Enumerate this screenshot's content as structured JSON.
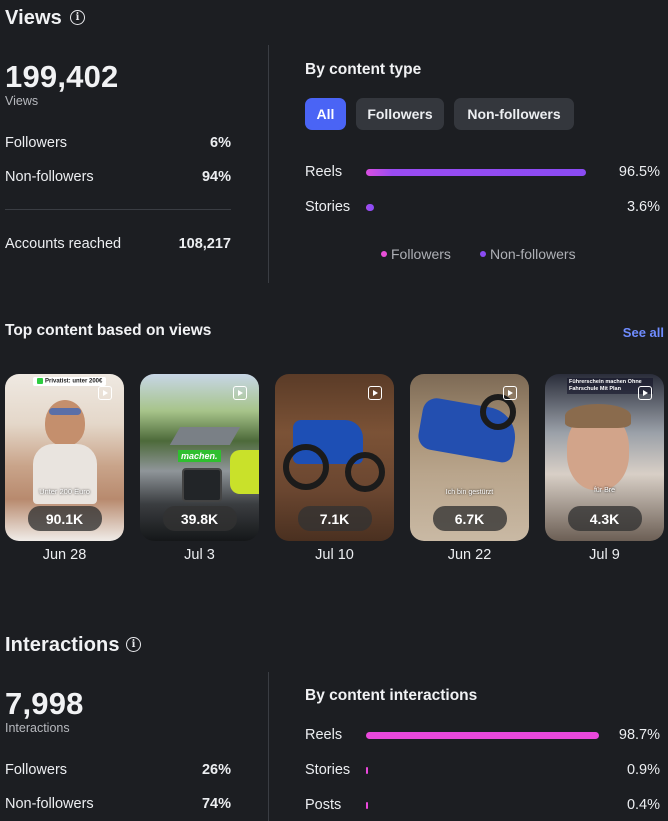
{
  "views": {
    "title": "Views",
    "total": "199,402",
    "total_label": "Views",
    "rows": [
      {
        "label": "Followers",
        "value": "6%"
      },
      {
        "label": "Non-followers",
        "value": "94%"
      }
    ],
    "accounts_reached_label": "Accounts reached",
    "accounts_reached_value": "108,217",
    "by_content": {
      "title": "By content type",
      "filters": [
        "All",
        "Followers",
        "Non-followers"
      ],
      "active_filter": "All",
      "bars": [
        {
          "label": "Reels",
          "value": "96.5%",
          "fraction": 0.965
        },
        {
          "label": "Stories",
          "value": "3.6%",
          "fraction": 0.036
        }
      ],
      "legend": [
        {
          "label": "Followers",
          "color": "#e84fd8"
        },
        {
          "label": "Non-followers",
          "color": "#8a4bf3"
        }
      ]
    }
  },
  "top_content": {
    "title": "Top content based on views",
    "see_all": "See all",
    "items": [
      {
        "views": "90.1K",
        "date": "Jun 28",
        "caption_top": "Privatist: unter 200€",
        "caption_mid": "Unter 200 Euro"
      },
      {
        "views": "39.8K",
        "date": "Jul 3",
        "caption_mid": "machen."
      },
      {
        "views": "7.1K",
        "date": "Jul 10"
      },
      {
        "views": "6.7K",
        "date": "Jun 22",
        "caption_mid": "Ich bin gestürzt"
      },
      {
        "views": "4.3K",
        "date": "Jul 9",
        "caption_top": "Führerschein machen Ohne Fahrschule Mit Plan",
        "caption_mid": "für Bre"
      }
    ]
  },
  "interactions": {
    "title": "Interactions",
    "total": "7,998",
    "total_label": "Interactions",
    "rows": [
      {
        "label": "Followers",
        "value": "26%"
      },
      {
        "label": "Non-followers",
        "value": "74%"
      }
    ],
    "by_content": {
      "title": "By content interactions",
      "bars": [
        {
          "label": "Reels",
          "value": "98.7%",
          "fraction": 0.987
        },
        {
          "label": "Stories",
          "value": "0.9%",
          "fraction": 0.009
        },
        {
          "label": "Posts",
          "value": "0.4%",
          "fraction": 0.004
        }
      ]
    }
  },
  "colors": {
    "background": "#1c1e22",
    "accent": "#4a64f5",
    "link": "#6f8cff",
    "bar_pink": "#ea48dc",
    "bar_purple": "#8a4bf3"
  }
}
